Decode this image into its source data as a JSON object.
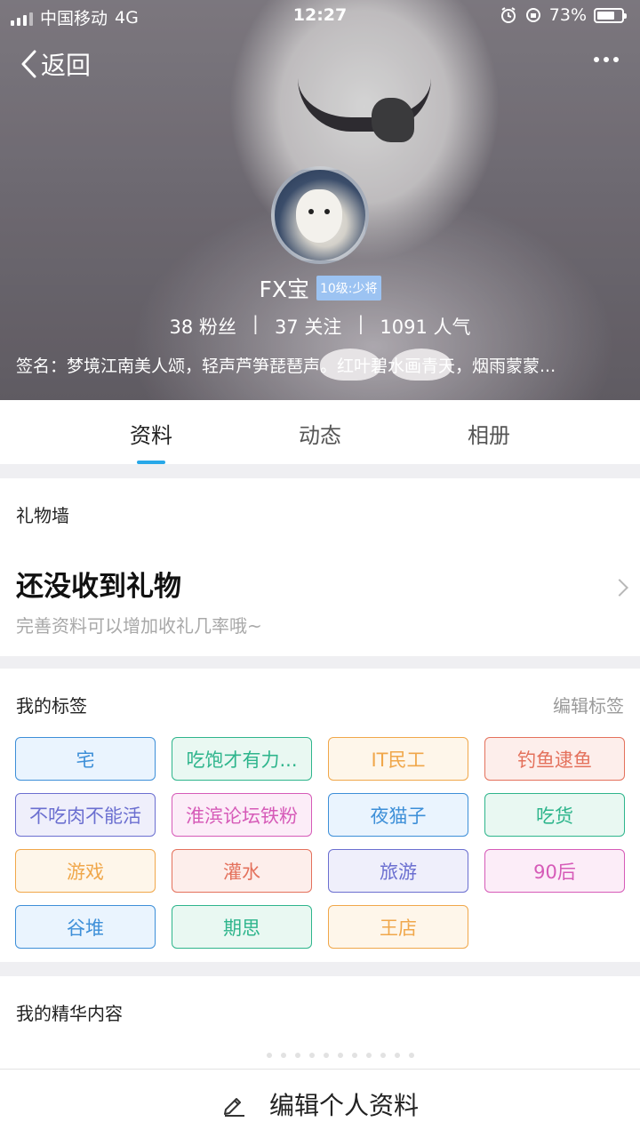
{
  "status_bar": {
    "carrier": "中国移动",
    "network": "4G",
    "time": "12:27",
    "battery_percent": "73%",
    "battery_level": 0.73
  },
  "nav": {
    "back_label": "返回",
    "more_icon": "more-icon"
  },
  "profile": {
    "nickname": "FX宝",
    "level": "10级:少将",
    "stats": [
      {
        "value": "38 粉丝"
      },
      {
        "value": "37 关注"
      },
      {
        "value": "1091 人气"
      }
    ],
    "signature": "签名：梦境江南美人颂，轻声芦笋琵琶声。红叶碧水画青天，烟雨蒙蒙..."
  },
  "tabs": [
    {
      "label": "资料",
      "active": true
    },
    {
      "label": "动态",
      "active": false
    },
    {
      "label": "相册",
      "active": false
    }
  ],
  "gift_wall": {
    "title": "礼物墙",
    "empty_title": "还没收到礼物",
    "empty_subtitle": "完善资料可以增加收礼几率哦~"
  },
  "my_tags": {
    "title": "我的标签",
    "edit_label": "编辑标签",
    "items": [
      {
        "label": "宅",
        "color": "#3d8fd8",
        "bg": "#eaf4fe"
      },
      {
        "label": "吃饱才有力...",
        "color": "#2eb58c",
        "bg": "#e9f8f2"
      },
      {
        "label": "IT民工",
        "color": "#f0a74a",
        "bg": "#fef6ea"
      },
      {
        "label": "钓鱼逮鱼",
        "color": "#e4715c",
        "bg": "#fdeeeb"
      },
      {
        "label": "不吃肉不能活",
        "color": "#6b6fd0",
        "bg": "#efeffb"
      },
      {
        "label": "淮滨论坛铁粉",
        "color": "#d65bb8",
        "bg": "#fcedf8"
      },
      {
        "label": "夜猫子",
        "color": "#3d8fd8",
        "bg": "#eaf4fe"
      },
      {
        "label": "吃货",
        "color": "#2eb58c",
        "bg": "#e9f8f2"
      },
      {
        "label": "游戏",
        "color": "#f0a74a",
        "bg": "#fef6ea"
      },
      {
        "label": "灌水",
        "color": "#e4715c",
        "bg": "#fdeeeb"
      },
      {
        "label": "旅游",
        "color": "#6b6fd0",
        "bg": "#efeffb"
      },
      {
        "label": "90后",
        "color": "#d65bb8",
        "bg": "#fcedf8"
      },
      {
        "label": "谷堆",
        "color": "#3d8fd8",
        "bg": "#eaf4fe"
      },
      {
        "label": "期思",
        "color": "#2eb58c",
        "bg": "#e9f8f2"
      },
      {
        "label": "王店",
        "color": "#f0a74a",
        "bg": "#fef6ea"
      }
    ]
  },
  "essence": {
    "title": "我的精华内容"
  },
  "bottom_bar": {
    "edit_label": "编辑个人资料",
    "icon": "pencil-icon"
  }
}
